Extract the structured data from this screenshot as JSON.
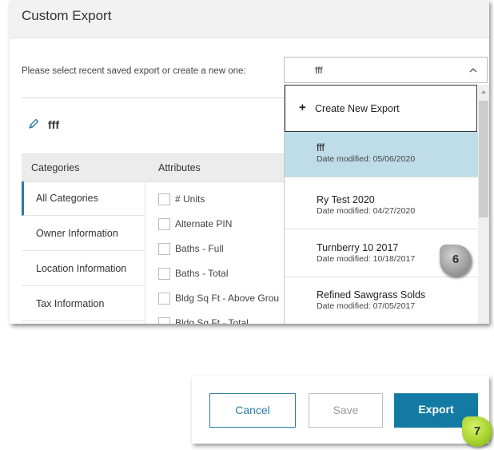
{
  "panel": {
    "title": "Custom Export",
    "prompt": "Please select recent saved export or create a new one:",
    "export_name": "fff",
    "icons": {
      "edit": "pencil-icon",
      "dropdown": "chevron-up-icon"
    }
  },
  "table": {
    "headers": {
      "categories": "Categories",
      "attributes": "Attributes"
    },
    "categories": [
      {
        "label": "All Categories",
        "active": true
      },
      {
        "label": "Owner Information",
        "active": false
      },
      {
        "label": "Location Information",
        "active": false
      },
      {
        "label": "Tax Information",
        "active": false
      }
    ],
    "attributes": [
      {
        "label": "# Units"
      },
      {
        "label": "Alternate PIN"
      },
      {
        "label": "Baths - Full"
      },
      {
        "label": "Baths - Total"
      },
      {
        "label": "Bldg Sq Ft - Above Grou"
      },
      {
        "label": "Bldg Sq Ft - Total"
      }
    ]
  },
  "dropdown": {
    "selected_value": "fff",
    "create_label": "Create New Export",
    "items": [
      {
        "name": "fff",
        "date": "Date modified: 05/06/2020",
        "selected": true
      },
      {
        "name": "Ry Test 2020",
        "date": "Date modified: 04/27/2020",
        "selected": false
      },
      {
        "name": "Turnberry 10 2017",
        "date": "Date modified: 10/18/2017",
        "selected": false
      },
      {
        "name": "Refined Sawgrass Solds",
        "date": "Date modified: 07/05/2017",
        "selected": false
      }
    ]
  },
  "actions": {
    "cancel": "Cancel",
    "save": "Save",
    "export": "Export"
  },
  "callouts": {
    "step6": "6",
    "step7": "7"
  },
  "colors": {
    "accent": "#137aa3",
    "selected_row": "#bfdce9",
    "callout_6": "#9a9a9a",
    "callout_7": "#a3cf2a"
  }
}
